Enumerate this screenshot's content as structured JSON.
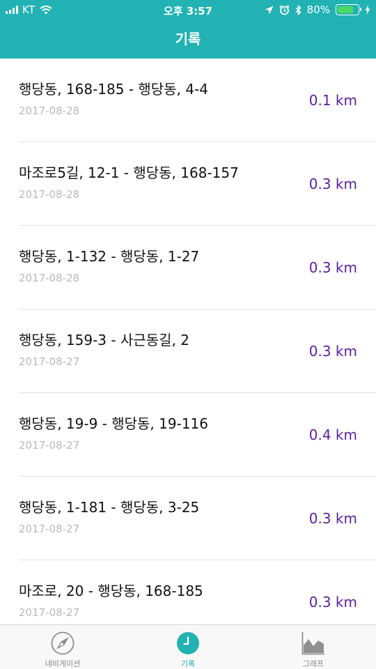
{
  "status_bar": {
    "carrier": "KT",
    "time": "오후 3:57",
    "battery_percent": "80%",
    "battery_level": 0.8
  },
  "nav": {
    "title": "기록"
  },
  "records": [
    {
      "route": "행당동, 168-185 - 행당동, 4-4",
      "date": "2017-08-28",
      "distance": "0.1 km"
    },
    {
      "route": "마조로5길, 12-1 - 행당동, 168-157",
      "date": "2017-08-28",
      "distance": "0.3 km"
    },
    {
      "route": "행당동, 1-132 - 행당동, 1-27",
      "date": "2017-08-28",
      "distance": "0.3 km"
    },
    {
      "route": "행당동, 159-3 - 사근동길, 2",
      "date": "2017-08-27",
      "distance": "0.3 km"
    },
    {
      "route": "행당동, 19-9 - 행당동, 19-116",
      "date": "2017-08-27",
      "distance": "0.4 km"
    },
    {
      "route": "행당동, 1-181 - 행당동, 3-25",
      "date": "2017-08-27",
      "distance": "0.3 km"
    },
    {
      "route": "마조로, 20 - 행당동, 168-185",
      "date": "2017-08-27",
      "distance": "0.3 km"
    }
  ],
  "tabs": [
    {
      "label": "네비게이션",
      "icon": "compass-icon",
      "active": false
    },
    {
      "label": "기록",
      "icon": "clock-icon",
      "active": true
    },
    {
      "label": "그래프",
      "icon": "area-chart-icon",
      "active": false
    }
  ],
  "colors": {
    "accent": "#22b2b3",
    "distance": "#5b1fa0",
    "date": "#b9b9b9"
  }
}
